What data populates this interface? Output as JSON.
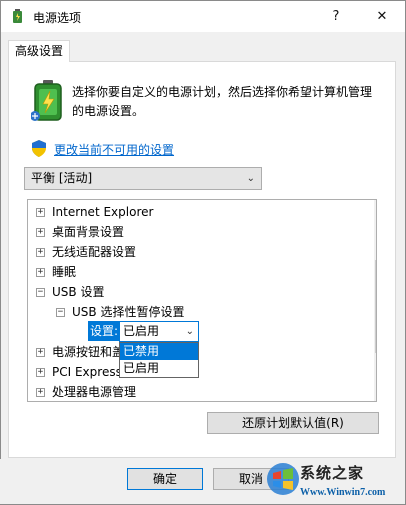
{
  "window": {
    "title": "电源选项",
    "help_glyph": "?",
    "close_glyph": "✕"
  },
  "tab": {
    "label": "高级设置"
  },
  "intro": {
    "text": "选择你要自定义的电源计划，然后选择你希望计算机管理的电源设置。"
  },
  "change_link": {
    "label": "更改当前不可用的设置"
  },
  "plan_select": {
    "value": "平衡 [活动]"
  },
  "tree": {
    "rows": [
      {
        "expander": "+",
        "label": "Internet Explorer"
      },
      {
        "expander": "+",
        "label": "桌面背景设置"
      },
      {
        "expander": "+",
        "label": "无线适配器设置"
      },
      {
        "expander": "+",
        "label": "睡眠"
      },
      {
        "expander": "−",
        "label": "USB 设置"
      },
      {
        "expander": "−",
        "label": "USB 选择性暂停设置"
      },
      {
        "expander": "",
        "label": ""
      },
      {
        "expander": "+",
        "label": "电源按钮和盖"
      },
      {
        "expander": "+",
        "label": "PCI Express"
      },
      {
        "expander": "+",
        "label": "处理器电源管理"
      }
    ],
    "setting_label": "设置:",
    "setting_value": "已启用",
    "dropdown_options": [
      "已禁用",
      "已启用"
    ],
    "dropdown_selected_index": 0
  },
  "buttons": {
    "restore": "还原计划默认值(R)",
    "ok": "确定",
    "cancel": "取消"
  },
  "watermark": {
    "title": "系统之家",
    "url": "Www.Winwin7.com"
  },
  "colors": {
    "accent": "#0078d7",
    "link": "#0066cc",
    "window_bg": "#f0f0f0"
  }
}
